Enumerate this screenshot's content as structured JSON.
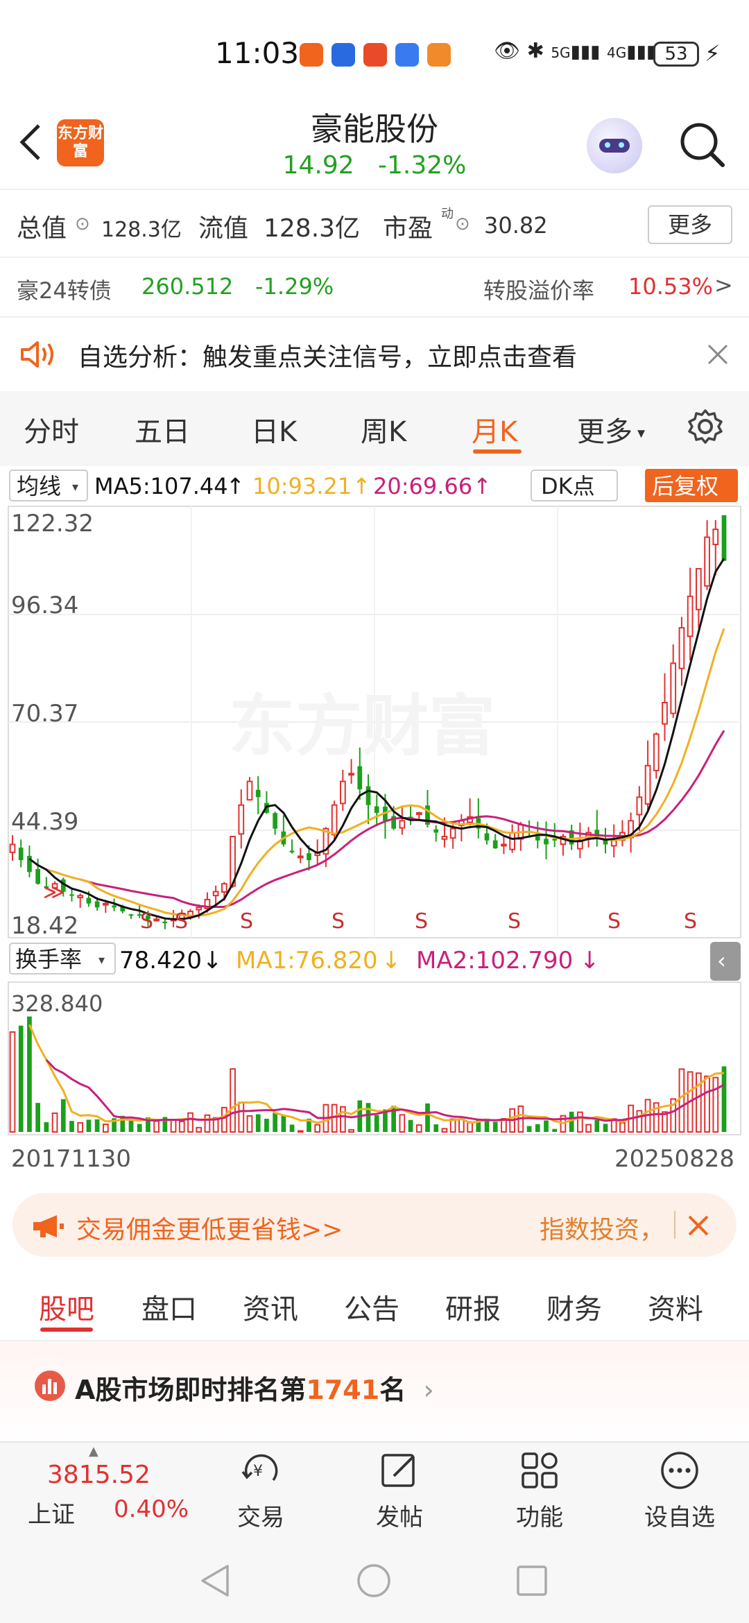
{
  "status_bar": {
    "time": "11:03",
    "battery": "53",
    "signal1": "5G",
    "signal2": "4G"
  },
  "header": {
    "logo_text": "东方财富",
    "stock_name": "豪能股份",
    "price": "14.92",
    "change_pct": "-1.32%"
  },
  "stats": {
    "total_cap_label": "总值",
    "total_cap_value": "128.3亿",
    "float_cap_label": "流值",
    "float_cap_value": "128.3亿",
    "pe_label": "市盈",
    "pe_sup": "动",
    "pe_value": "30.82",
    "more_button": "更多"
  },
  "bond": {
    "name": "豪24转债",
    "price": "260.512",
    "change": "-1.29%",
    "premium_label": "转股溢价率",
    "premium_value": "10.53%"
  },
  "notice": {
    "text": "自选分析：触发重点关注信号，立即点击查看"
  },
  "period_tabs": [
    "分时",
    "五日",
    "日K",
    "周K",
    "月K",
    "更多"
  ],
  "active_period": "月K",
  "ma_legend": {
    "selector": "均线",
    "ma5": "MA5:107.44",
    "ma10": "10:93.21",
    "ma20": "20:69.66",
    "dk_button": "DK点",
    "rights_button": "后复权"
  },
  "price_axis_labels": [
    "122.32",
    "96.34",
    "70.37",
    "44.39",
    "18.42"
  ],
  "turnover_legend": {
    "selector": "换手率",
    "value": "78.420",
    "ma1": "MA1:76.820",
    "ma2": "MA2:102.790",
    "axis_max": "328.840"
  },
  "date_range": {
    "start": "20171130",
    "end": "20250828"
  },
  "signal_marker": "S",
  "watermark": "东方财富",
  "colors": {
    "up": "#e23030",
    "down": "#1ba01b",
    "ma5": "#111111",
    "ma10": "#f0b020",
    "ma20": "#c8207a",
    "accent": "#f0641e"
  },
  "chart_data": {
    "type": "candlestick",
    "period": "monthly",
    "x_range": [
      "20171130",
      "20250828"
    ],
    "ylim": [
      18.42,
      122.32
    ],
    "indicators": {
      "MA5": 107.44,
      "MA10": 93.21,
      "MA20": 69.66
    },
    "closes": [
      40,
      36,
      33,
      30,
      29,
      30,
      28,
      27,
      27,
      25,
      24,
      25,
      24,
      23,
      22,
      22,
      21,
      21,
      20,
      21,
      22,
      23,
      24,
      26,
      28,
      30,
      42,
      50,
      56,
      52,
      48,
      44,
      40,
      38,
      37,
      36,
      38,
      44,
      50,
      56,
      58,
      54,
      50,
      48,
      46,
      44,
      46,
      47,
      48,
      45,
      43,
      42,
      44,
      46,
      47,
      44,
      41,
      39,
      40,
      43,
      45,
      43,
      41,
      40,
      41,
      42,
      40,
      41,
      43,
      42,
      40,
      41,
      43,
      46,
      52,
      60,
      68,
      76,
      86,
      95,
      103,
      110,
      118,
      120,
      112
    ],
    "turnover": {
      "value": 78.42,
      "MA1": 76.82,
      "MA2": 102.79,
      "max": 328.84
    }
  },
  "ad": {
    "text": "交易佣金更低更省钱>>",
    "right_text": "指数投资，"
  },
  "section_tabs": [
    "股吧",
    "盘口",
    "资讯",
    "公告",
    "研报",
    "财务",
    "资料"
  ],
  "active_section": "股吧",
  "rank": {
    "prefix": "A股市场即时排名第",
    "number": "1741",
    "suffix": "名"
  },
  "bottom_nav": {
    "index_value": "3815.52",
    "index_name": "上证",
    "index_change": "0.40%",
    "items": [
      "交易",
      "发帖",
      "功能",
      "设自选"
    ]
  }
}
